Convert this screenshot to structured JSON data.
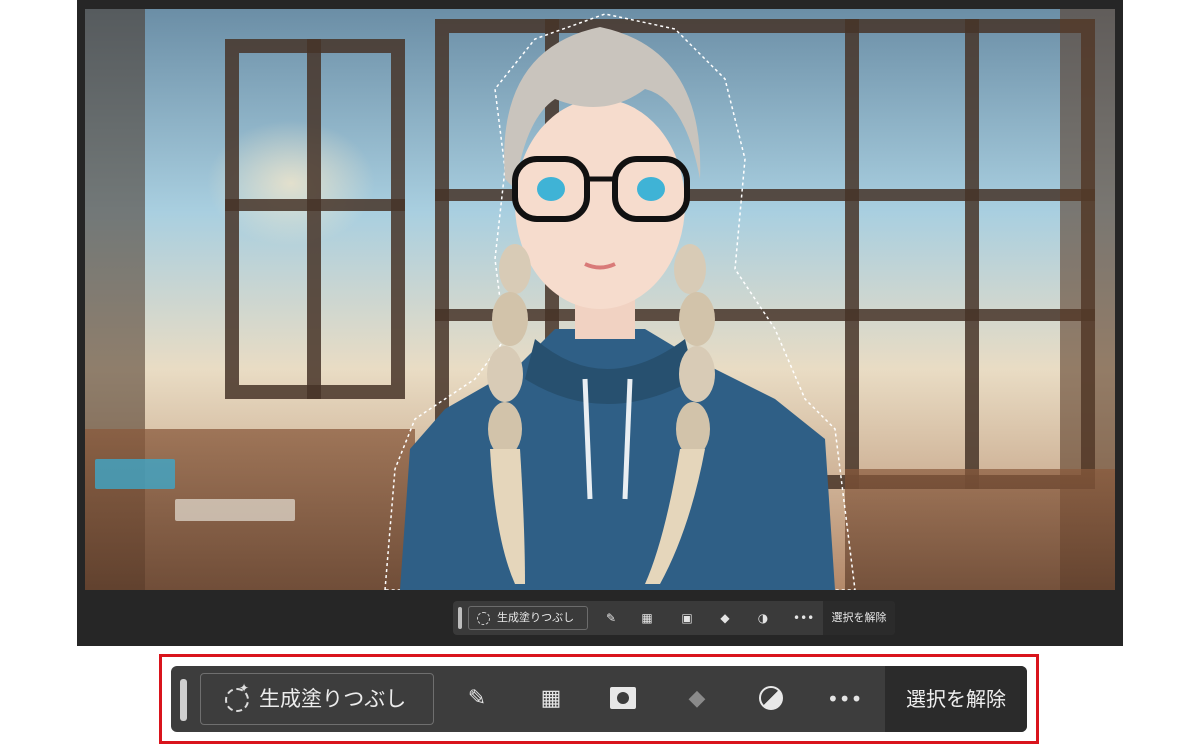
{
  "toolbar": {
    "generative_fill_label": "生成塗りつぶし",
    "deselect_label": "選択を解除",
    "icons": [
      "brush-icon",
      "selection-transform-icon",
      "mask-icon",
      "fill-bucket-icon",
      "adjustment-icon",
      "more-icon"
    ],
    "more_label": "•••"
  },
  "colors": {
    "callout_border": "#d9141c",
    "toolbar_bg": "#3d3d3d",
    "deselect_bg": "#2b2b2b"
  }
}
